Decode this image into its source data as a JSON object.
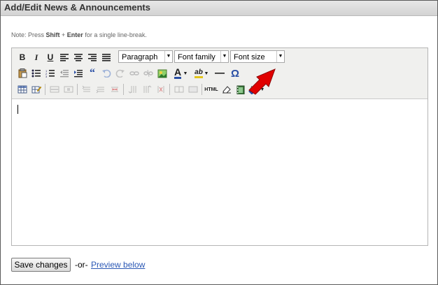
{
  "header": {
    "title": "Add/Edit News & Announcements"
  },
  "note": {
    "prefix": "Note: Press ",
    "key1": "Shift",
    "plus": " + ",
    "key2": "Enter",
    "suffix": " for a single line-break."
  },
  "toolbar": {
    "bold": "B",
    "italic": "I",
    "underline": "U",
    "format_select": "Paragraph",
    "font_family_select": "Font family",
    "font_size_select": "Font size",
    "blockquote": "“",
    "font_color": "A",
    "highlight": "ab",
    "omega": "Ω",
    "html": "HTML"
  },
  "actions": {
    "save_label": "Save changes",
    "or_label": "-or-",
    "preview_label": "Preview below"
  },
  "colors": {
    "arrow": "#e10000",
    "link": "#2b58b5"
  }
}
